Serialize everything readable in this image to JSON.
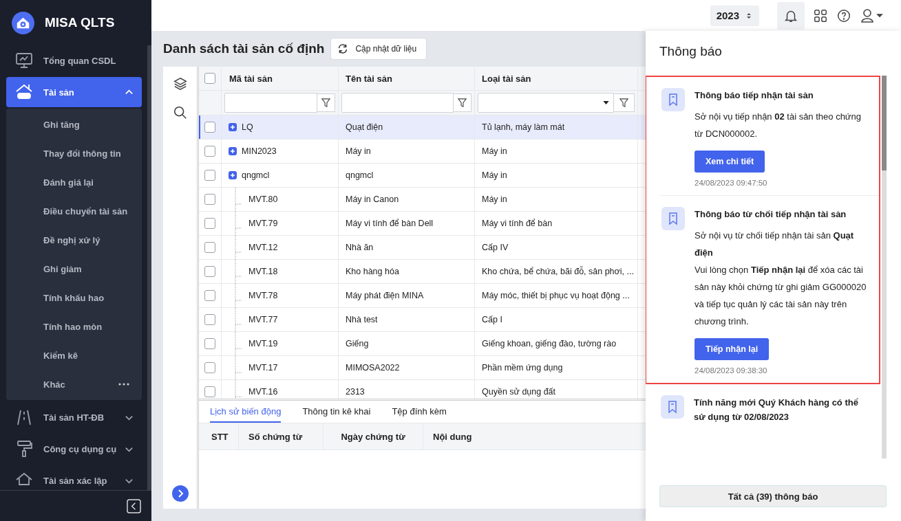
{
  "app": {
    "name": "MISA QLTS"
  },
  "sidebar": {
    "items": [
      {
        "label": "Tổng quan CSDL",
        "selected": false
      },
      {
        "label": "Tài sản",
        "selected": true,
        "expanded": true,
        "children": [
          {
            "label": "Ghi tăng"
          },
          {
            "label": "Thay đổi thông tin"
          },
          {
            "label": "Đánh giá lại"
          },
          {
            "label": "Điều chuyển tài sản"
          },
          {
            "label": "Đề nghị xử lý"
          },
          {
            "label": "Ghi giảm"
          },
          {
            "label": "Tính khấu hao"
          },
          {
            "label": "Tính hao mòn"
          },
          {
            "label": "Kiểm kê"
          },
          {
            "label": "Khác",
            "more": true
          }
        ]
      },
      {
        "label": "Tài sản HT-ĐB",
        "selected": false,
        "expanded": false
      },
      {
        "label": "Công cụ dụng cụ",
        "selected": false,
        "expanded": false
      },
      {
        "label": "Tài sản xác lập",
        "selected": false,
        "expanded": false
      }
    ]
  },
  "topbar": {
    "year": "2023"
  },
  "page": {
    "title": "Danh sách tài sản cố định",
    "refresh_button": "Cập nhật dữ liệu"
  },
  "table": {
    "columns": [
      "Mã tài sản",
      "Tên tài sản",
      "Loại tài sản"
    ],
    "all_checked": false,
    "rows": [
      {
        "kind": "group",
        "code": "LQ",
        "name": "Quạt điện",
        "type": "Tủ lạnh, máy làm mát",
        "selected": true,
        "checked": false
      },
      {
        "kind": "group",
        "code": "MIN2023",
        "name": "Máy in",
        "type": "Máy in",
        "selected": false,
        "checked": false
      },
      {
        "kind": "group",
        "code": "qngmcl",
        "name": "qngmcl",
        "type": "Máy in",
        "selected": false,
        "checked": false
      },
      {
        "kind": "child",
        "code": "MVT.80",
        "name": "Máy in Canon",
        "type": "Máy in",
        "selected": false,
        "checked": false
      },
      {
        "kind": "child",
        "code": "MVT.79",
        "name": "Máy vi tính để bàn Dell",
        "type": "Máy vi tính để bàn",
        "selected": false,
        "checked": false
      },
      {
        "kind": "child",
        "code": "MVT.12",
        "name": "Nhà ăn",
        "type": "Cấp IV",
        "selected": false,
        "checked": false
      },
      {
        "kind": "child",
        "code": "MVT.18",
        "name": "Kho hàng hóa",
        "type": "Kho chứa, bể chứa, bãi đỗ, sân phơi, ...",
        "selected": false,
        "checked": false
      },
      {
        "kind": "child",
        "code": "MVT.78",
        "name": "Máy phát điện MINA",
        "type": "Máy móc, thiết bị phục vụ hoạt động ...",
        "selected": false,
        "checked": false
      },
      {
        "kind": "child",
        "code": "MVT.77",
        "name": "Nhà test",
        "type": "Cấp I",
        "selected": false,
        "checked": false
      },
      {
        "kind": "child",
        "code": "MVT.19",
        "name": "Giếng",
        "type": "Giếng khoan, giếng đào, tường rào",
        "selected": false,
        "checked": false
      },
      {
        "kind": "child",
        "code": "MVT.17",
        "name": "MIMOSA2022",
        "type": "Phần mềm ứng dụng",
        "selected": false,
        "checked": false
      },
      {
        "kind": "child",
        "code": "MVT.16",
        "name": "2313",
        "type": "Quyền sử dụng đất",
        "selected": false,
        "checked": false
      }
    ]
  },
  "detail": {
    "tabs": [
      {
        "label": "Lịch sử biến động",
        "selected": true
      },
      {
        "label": "Thông tin kê khai",
        "selected": false
      },
      {
        "label": "Tệp đính kèm",
        "selected": false
      }
    ],
    "columns": [
      "STT",
      "Số chứng từ",
      "Ngày chứng từ",
      "Nội dung"
    ]
  },
  "notifications": {
    "title": "Thông báo",
    "items": [
      {
        "title": "Thông báo tiếp nhận tài sản",
        "highlighted": true,
        "body": [
          "Sở nội vụ tiếp nhận **02** tài sản theo chứng từ DCN000002."
        ],
        "button": "Xem chi tiết",
        "time": "24/08/2023 09:47:50"
      },
      {
        "title": "Thông báo từ chối tiếp nhận tài sản",
        "highlighted": true,
        "body": [
          "Sở nội vụ từ chối tiếp nhận tài sản **Quạt điện**",
          "Vui lòng chọn **Tiếp nhận lại** để xóa các tài sản này khỏi chứng từ ghi giảm GG000020 và tiếp tục quản lý các tài sản này trên chương trình."
        ],
        "button": "Tiếp nhận lại",
        "time": "24/08/2023 09:38:30"
      },
      {
        "title": "Tính năng mới Quý Khách hàng có thể sử dụng từ 02/08/2023",
        "highlighted": false
      }
    ],
    "all_button": "Tất cả (39) thông báo"
  }
}
